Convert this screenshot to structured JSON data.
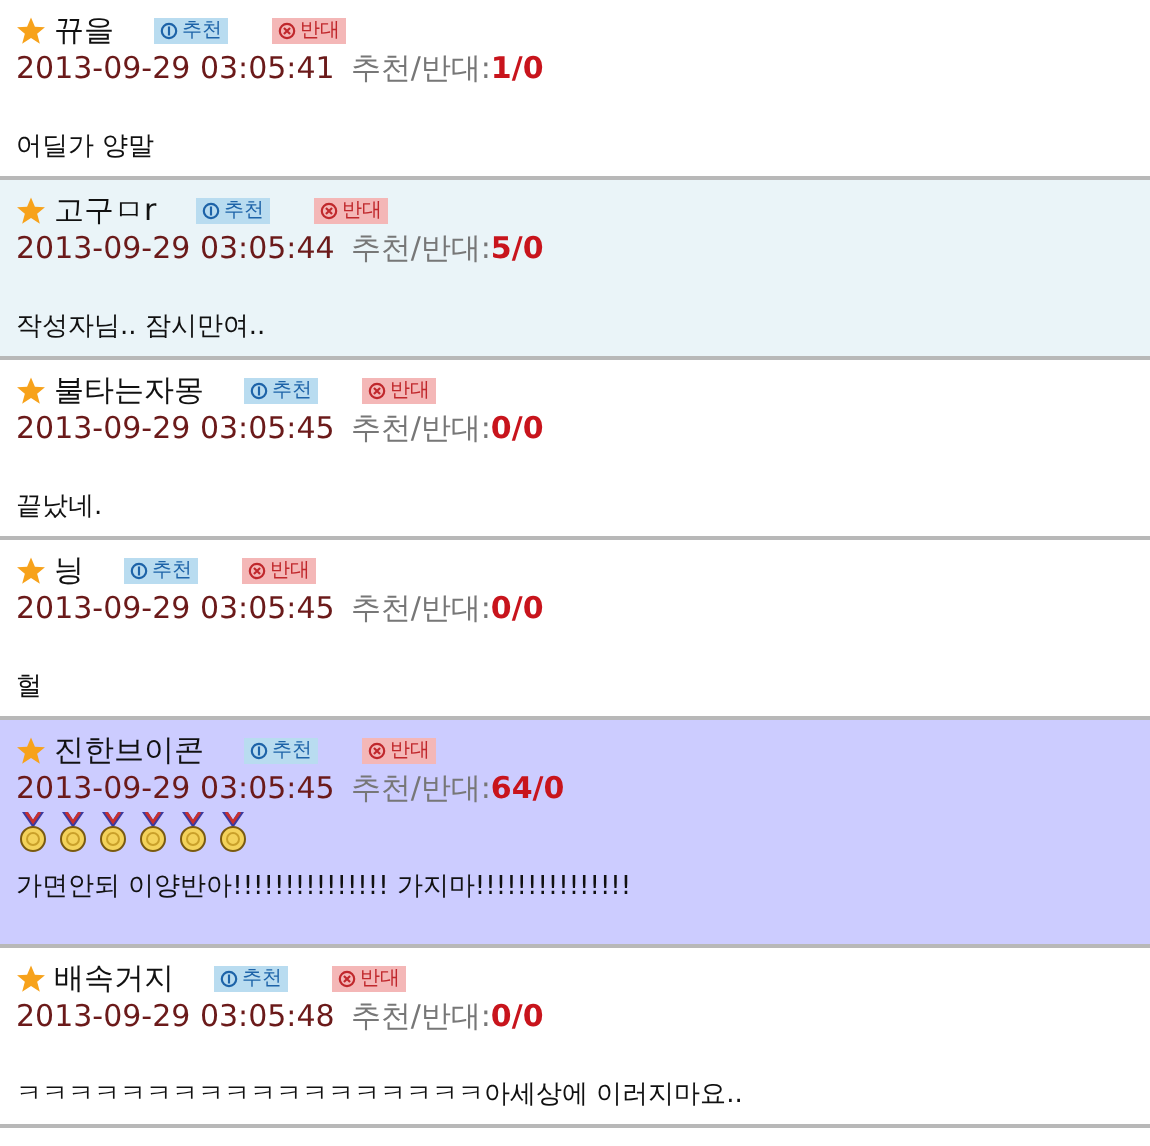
{
  "comments": [
    {
      "author": "뀨을",
      "up_label": "추천",
      "down_label": "반대",
      "time": "2013-09-29 03:05:41",
      "votes_label": "추천/반대:",
      "votes": "1/0",
      "text": "어딜가 양말",
      "color": "#ffffff"
    },
    {
      "author": "고구ㅁr",
      "up_label": "추천",
      "down_label": "반대",
      "time": "2013-09-29 03:05:44",
      "votes_label": "추천/반대:",
      "votes": "5/0",
      "text": "작성자님.. 잠시만여..",
      "color": "#eaf4f8"
    },
    {
      "author": "불타는자몽",
      "up_label": "추천",
      "down_label": "반대",
      "time": "2013-09-29 03:05:45",
      "votes_label": "추천/반대:",
      "votes": "0/0",
      "text": "끝났네.",
      "color": "#ffffff"
    },
    {
      "author": "닁",
      "up_label": "추천",
      "down_label": "반대",
      "time": "2013-09-29 03:05:45",
      "votes_label": "추천/반대:",
      "votes": "0/0",
      "text": "헐",
      "color": "#ffffff"
    },
    {
      "author": "진한브이콘",
      "up_label": "추천",
      "down_label": "반대",
      "time": "2013-09-29 03:05:45",
      "votes_label": "추천/반대:",
      "votes": "64/0",
      "text": "가면안되 이양반아!!!!!!!!!!!!!!! 가지마!!!!!!!!!!!!!!!",
      "color": "#ccccff",
      "awards": [
        {
          "kind": "medal"
        },
        {
          "kind": "medal"
        },
        {
          "kind": "medal"
        },
        {
          "kind": "medal"
        },
        {
          "kind": "medal"
        },
        {
          "kind": "medal"
        }
      ]
    },
    {
      "author": "배속거지",
      "up_label": "추천",
      "down_label": "반대",
      "time": "2013-09-29 03:05:48",
      "votes_label": "추천/반대:",
      "votes": "0/0",
      "text": "ㅋㅋㅋㅋㅋㅋㅋㅋㅋㅋㅋㅋㅋㅋㅋㅋㅋㅋ아세상에 이러지마요..",
      "color": "#ffffff"
    }
  ]
}
